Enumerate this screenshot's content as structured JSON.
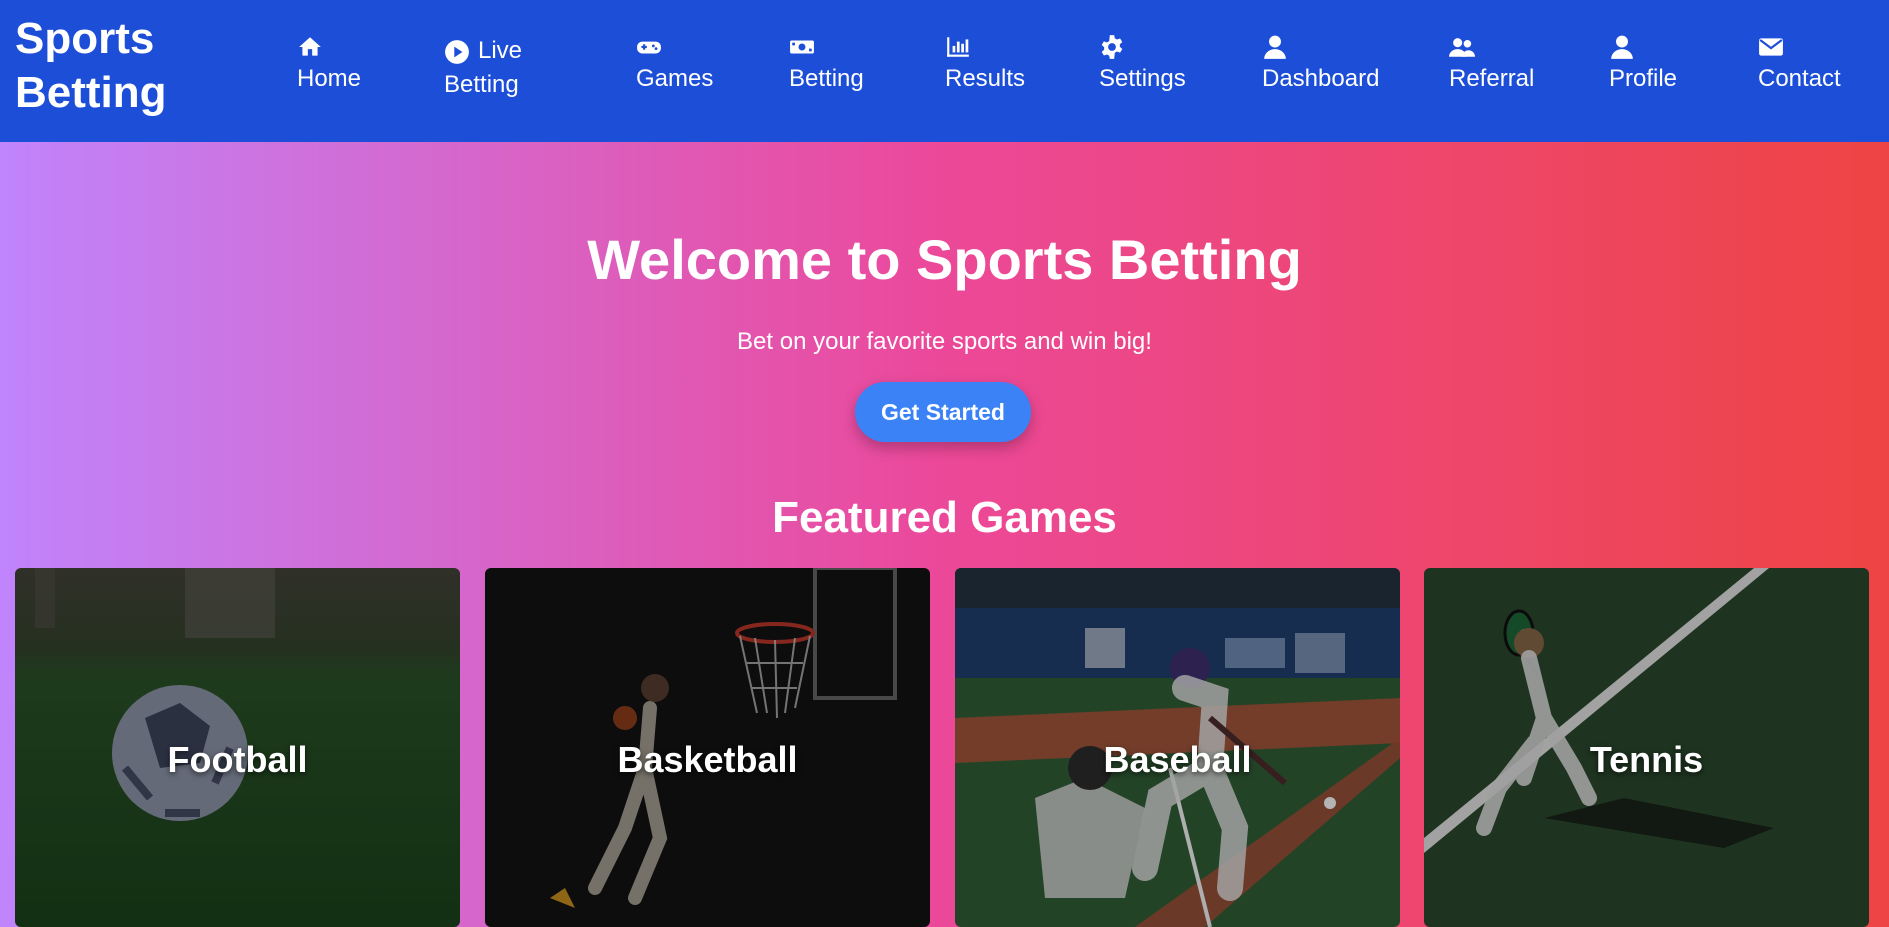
{
  "brand": {
    "title": "Sports Betting"
  },
  "nav": {
    "items": [
      {
        "label": "Home",
        "icon": "home-icon"
      },
      {
        "label_line1": "Live",
        "label_line2": "Betting",
        "icon": "play-circle-icon"
      },
      {
        "label": "Games",
        "icon": "gamepad-icon"
      },
      {
        "label": "Betting",
        "icon": "money-bill-icon"
      },
      {
        "label": "Results",
        "icon": "bar-chart-icon"
      },
      {
        "label": "Settings",
        "icon": "gear-icon"
      },
      {
        "label": "Dashboard",
        "icon": "user-icon"
      },
      {
        "label": "Referral",
        "icon": "users-icon"
      },
      {
        "label": "Profile",
        "icon": "user-icon"
      },
      {
        "label": "Contact",
        "icon": "envelope-icon"
      }
    ]
  },
  "hero": {
    "title": "Welcome to Sports Betting",
    "subtitle": "Bet on your favorite sports and win big!",
    "cta_label": "Get Started"
  },
  "featured": {
    "title": "Featured Games",
    "cards": [
      {
        "label": "Football"
      },
      {
        "label": "Basketball"
      },
      {
        "label": "Baseball"
      },
      {
        "label": "Tennis"
      }
    ]
  },
  "colors": {
    "navbar": "#1d4ed8",
    "gradient_start": "#c084fc",
    "gradient_mid": "#ec4899",
    "gradient_end": "#ef4444",
    "cta": "#3b82f6"
  }
}
